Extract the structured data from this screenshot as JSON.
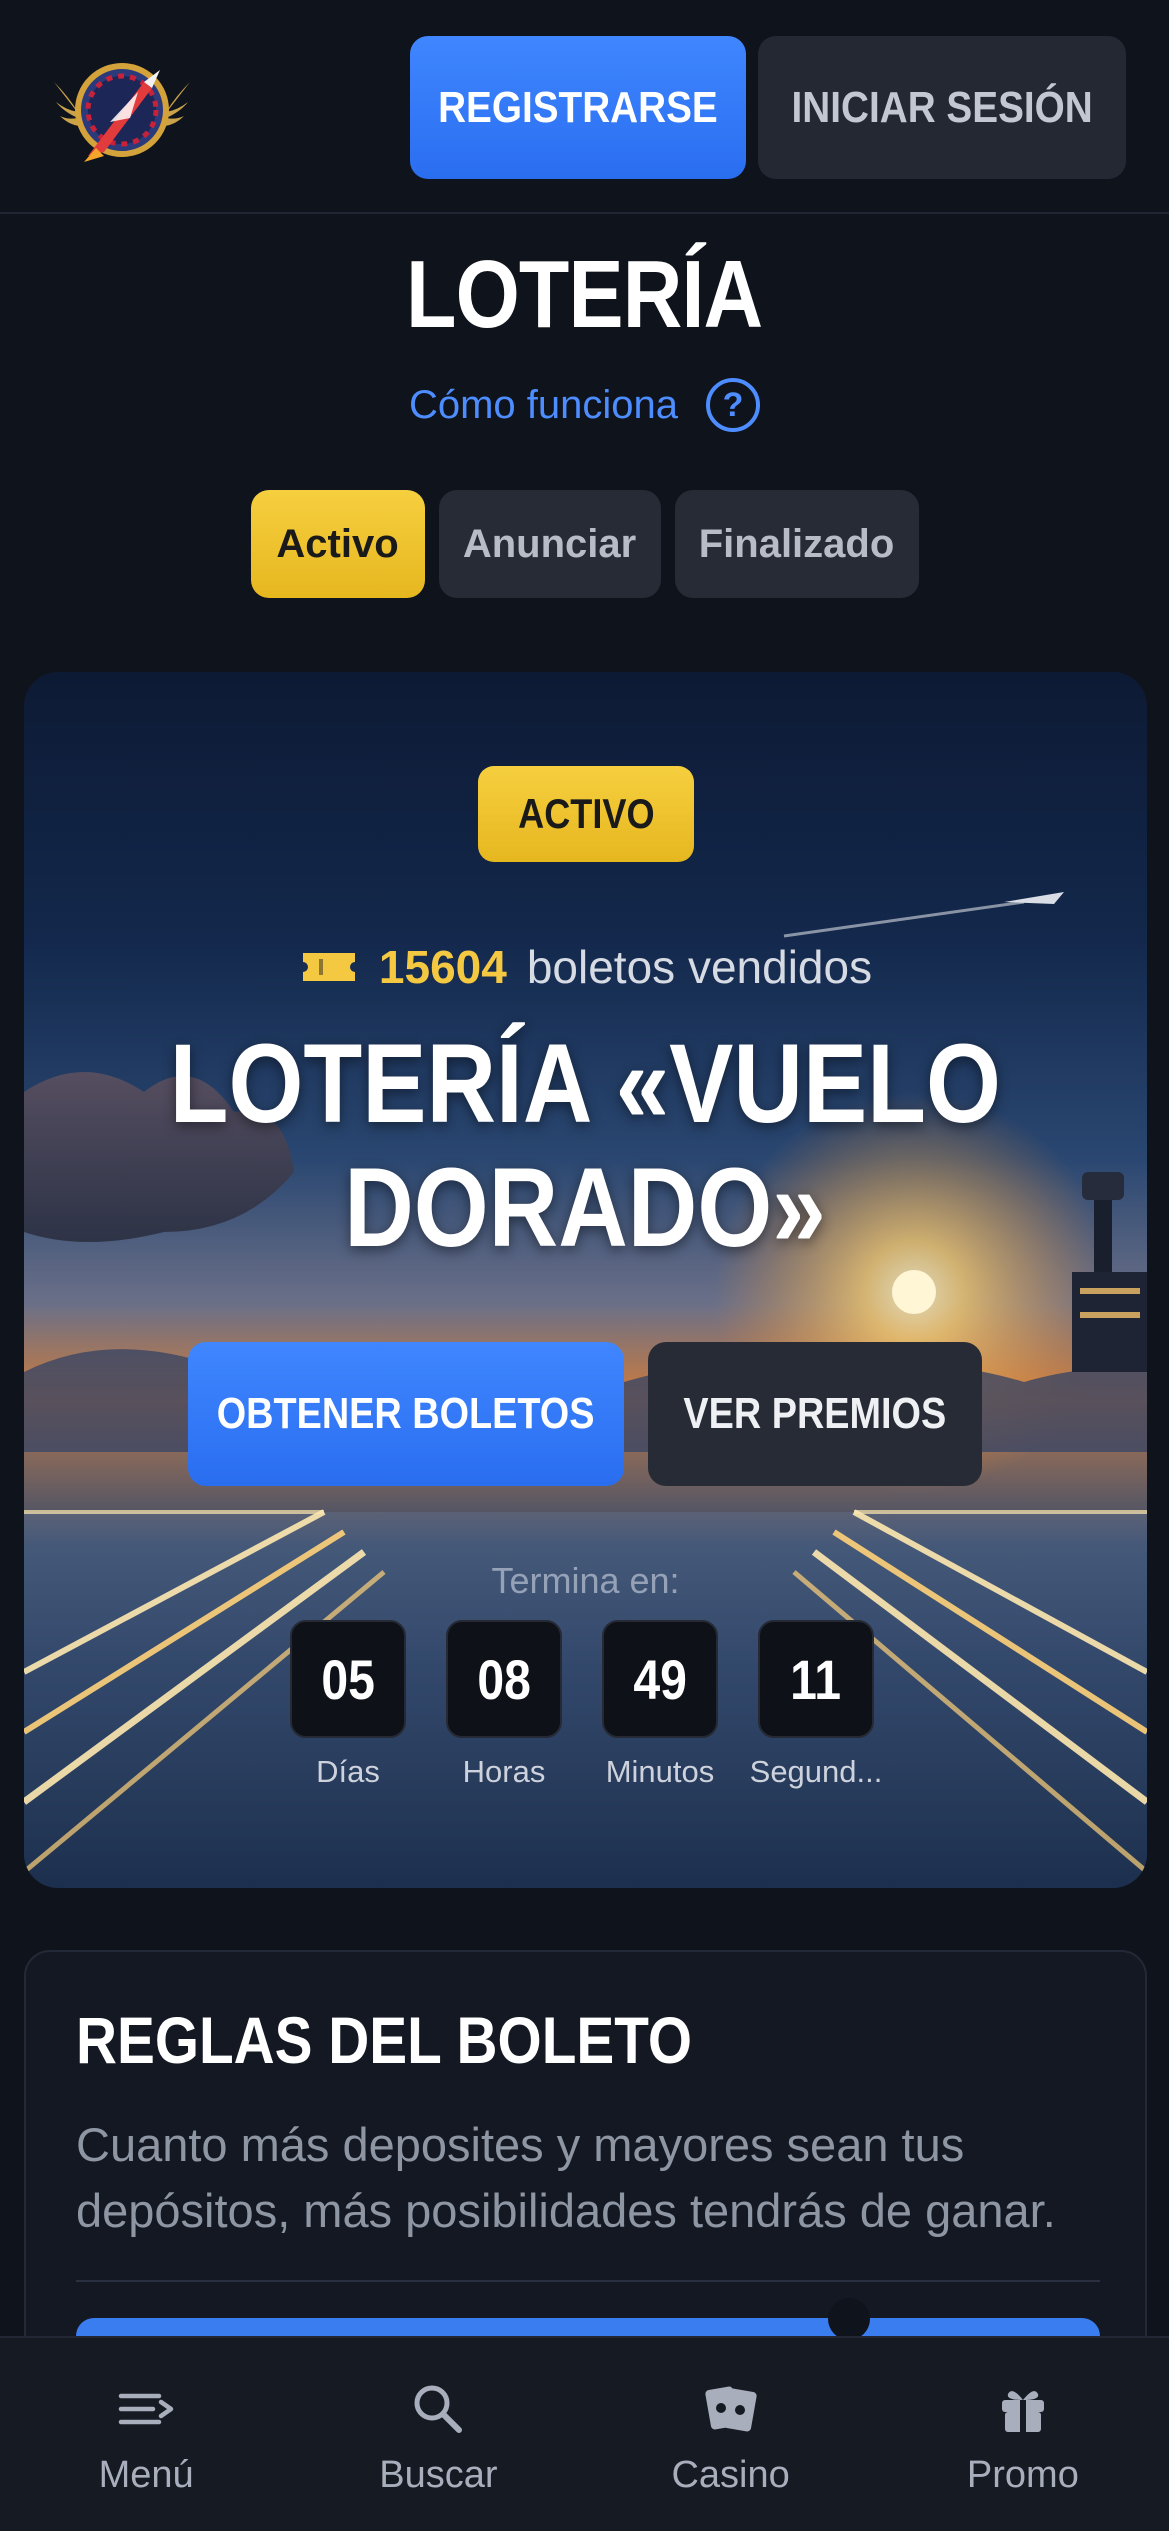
{
  "header": {
    "register_label": "REGISTRARSE",
    "login_label": "INICIAR SESIÓN"
  },
  "page": {
    "title": "LOTERÍA",
    "how_it_works": "Cómo funciona",
    "help_glyph": "?"
  },
  "tabs": [
    {
      "label": "Activo",
      "active": true
    },
    {
      "label": "Anunciar",
      "active": false
    },
    {
      "label": "Finalizado",
      "active": false
    }
  ],
  "hero": {
    "badge": "ACTIVO",
    "tickets_count": "15604",
    "tickets_label": "boletos vendidos",
    "title_line1": "LOTERÍA «VUELO",
    "title_line2": "DORADO»",
    "get_tickets_label": "OBTENER BOLETOS",
    "view_prizes_label": "VER PREMIOS",
    "ends_in_label": "Termina en:",
    "countdown": [
      {
        "value": "05",
        "label": "Días"
      },
      {
        "value": "08",
        "label": "Horas"
      },
      {
        "value": "49",
        "label": "Minutos"
      },
      {
        "value": "11",
        "label": "Segund..."
      }
    ]
  },
  "rules": {
    "title": "REGLAS DEL BOLETO",
    "text": "Cuanto más deposites y mayores sean tus depósitos, más posibilidades tendrás de ganar."
  },
  "bottom_nav": [
    {
      "label": "Menú",
      "icon": "menu-icon"
    },
    {
      "label": "Buscar",
      "icon": "search-icon"
    },
    {
      "label": "Casino",
      "icon": "cards-icon"
    },
    {
      "label": "Promo",
      "icon": "gift-icon"
    }
  ],
  "colors": {
    "background": "#0f131b",
    "primary": "#2f77f5",
    "accent_yellow": "#f5c842",
    "secondary_button": "#262b35"
  }
}
